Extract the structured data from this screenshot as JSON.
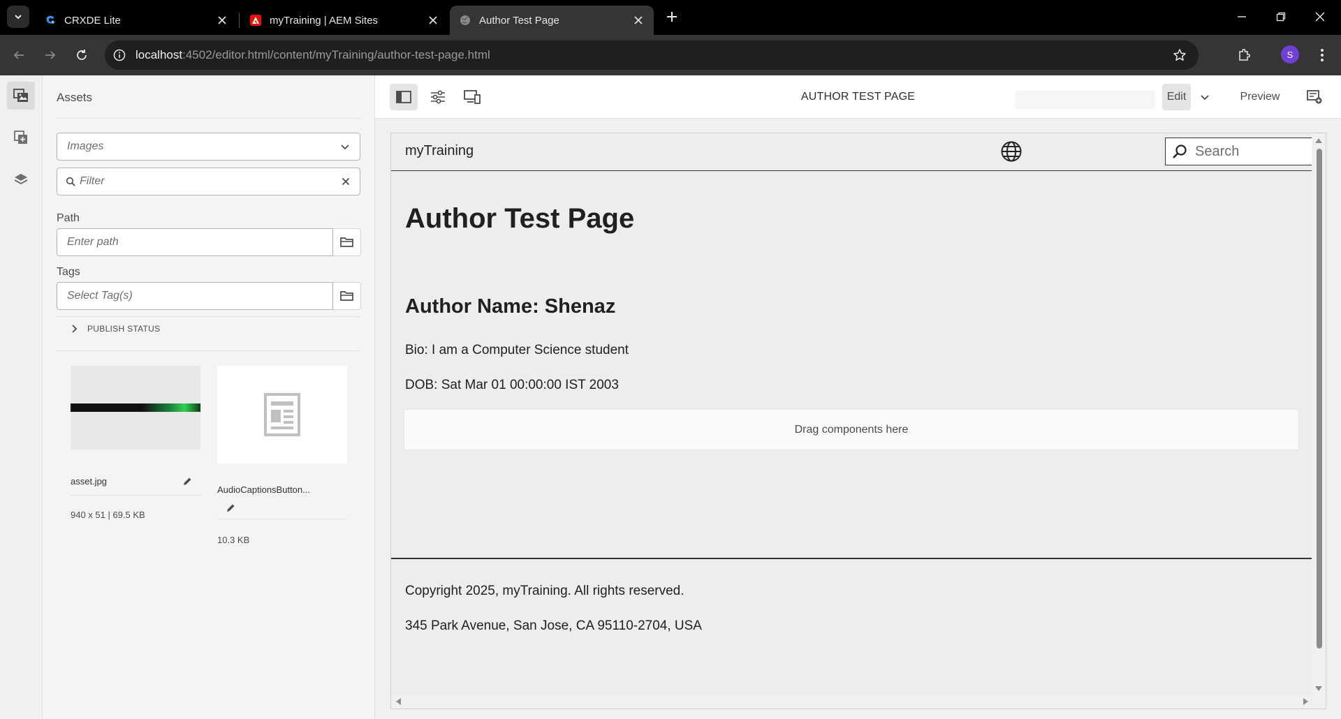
{
  "browser": {
    "tabs": [
      {
        "title": "CRXDE Lite",
        "icon": "crxde-icon",
        "active": false
      },
      {
        "title": "myTraining | AEM Sites",
        "icon": "adobe-icon",
        "active": false
      },
      {
        "title": "Author Test Page",
        "icon": "globe-favicon",
        "active": true
      }
    ],
    "url_host": "localhost",
    "url_path": ":4502/editor.html/content/myTraining/author-test-page.html",
    "profile_initial": "S",
    "profile_color": "#6f3fd6"
  },
  "rail": {
    "items": [
      {
        "name": "assets",
        "icon": "assets-icon",
        "selected": true
      },
      {
        "name": "components",
        "icon": "components-icon",
        "selected": false
      },
      {
        "name": "layers",
        "icon": "layers-icon",
        "selected": false
      }
    ]
  },
  "panel": {
    "title": "Assets",
    "type_select": {
      "value": "Images"
    },
    "filter": {
      "placeholder": "Filter"
    },
    "path": {
      "label": "Path",
      "placeholder": "Enter path"
    },
    "tags": {
      "label": "Tags",
      "placeholder": "Select Tag(s)"
    },
    "publish_status": "PUBLISH STATUS",
    "assets": [
      {
        "name": "asset.jpg",
        "meta": "940 x 51 | 69.5 KB"
      },
      {
        "name": "AudioCaptionsButton...",
        "meta": "10.3 KB"
      }
    ]
  },
  "toolbar": {
    "page_title": "AUTHOR TEST PAGE",
    "edit_label": "Edit",
    "preview_label": "Preview"
  },
  "site": {
    "brand": "myTraining",
    "search_placeholder": "Search",
    "title": "Author Test Page",
    "author_heading": "Author Name: Shenaz",
    "bio": "Bio: I am a Computer Science student",
    "dob": "DOB: Sat Mar 01 00:00:00 IST 2003",
    "dropzone": "Drag components here",
    "copyright": "Copyright 2025, myTraining. All rights reserved.",
    "address": "345 Park Avenue, San Jose, CA 95110-2704, USA"
  },
  "colors": {
    "adobe_red": "#eb1000",
    "accent_purple": "#6f3fd6",
    "crxde_blue": "#3d8ee6"
  }
}
